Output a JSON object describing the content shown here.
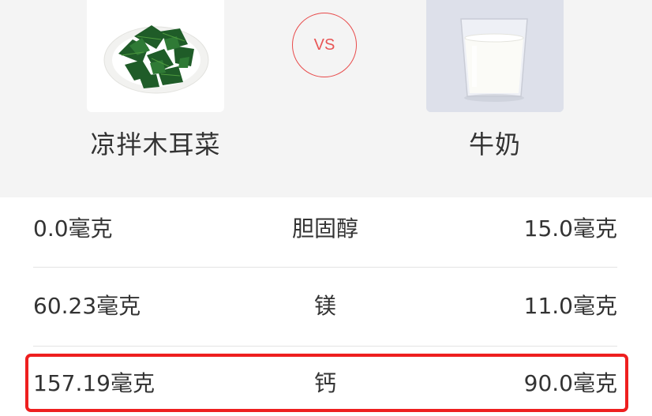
{
  "comparison": {
    "vs_label": "VS",
    "left_food": {
      "name": "凉拌木耳菜",
      "image_icon": "greens-on-plate-image"
    },
    "right_food": {
      "name": "牛奶",
      "image_icon": "glass-of-milk-image"
    }
  },
  "nutrients": [
    {
      "left_value": "0.0毫克",
      "name": "胆固醇",
      "right_value": "15.0毫克"
    },
    {
      "left_value": "60.23毫克",
      "name": "镁",
      "right_value": "11.0毫克"
    },
    {
      "left_value": "157.19毫克",
      "name": "钙",
      "right_value": "90.0毫克",
      "highlighted": true
    }
  ],
  "colors": {
    "header_background": "#f4f4f4",
    "vs_accent": "#e84a4a",
    "highlight_border": "#ee1f1f",
    "text": "#333333",
    "divider": "#e3e3e3"
  }
}
